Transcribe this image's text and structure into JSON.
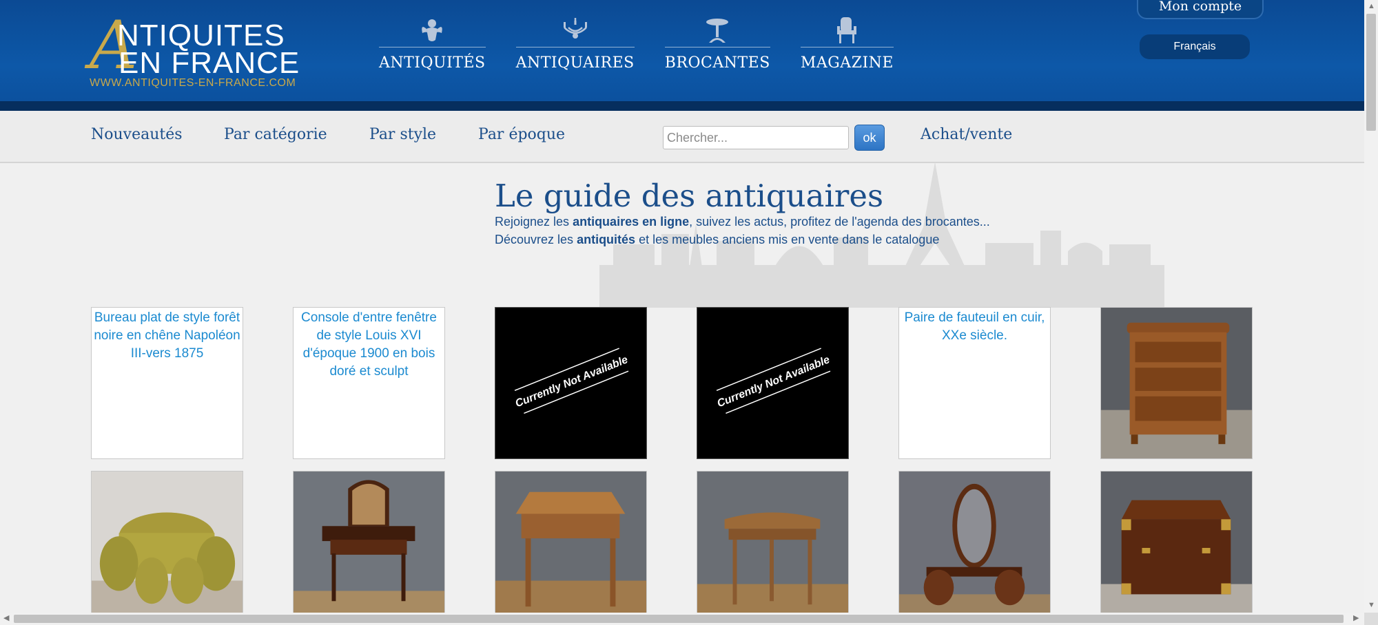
{
  "logo": {
    "initial": "A",
    "line1": "NTIQUITES",
    "line2": "EN FRANCE",
    "url": "WWW.ANTIQUITES-EN-FRANCE.COM",
    "gold": "#c9a94b"
  },
  "main_nav": [
    {
      "label": "ANTIQUITÉS",
      "icon": "cherub-icon"
    },
    {
      "label": "ANTIQUAIRES",
      "icon": "chandelier-icon"
    },
    {
      "label": "BROCANTES",
      "icon": "pedestal-table-icon"
    },
    {
      "label": "MAGAZINE",
      "icon": "armchair-icon"
    }
  ],
  "account": {
    "label": "Mon compte"
  },
  "language": {
    "label": "Français"
  },
  "sub_nav": {
    "links": [
      "Nouveautés",
      "Par catégorie",
      "Par style",
      "Par époque"
    ],
    "search_placeholder": "Chercher...",
    "ok_label": "ok",
    "buy_sell": "Achat/vente"
  },
  "page": {
    "title": "Le guide des antiquaires",
    "intro": {
      "l1_pre": "Rejoignez les ",
      "l1_bold": "antiquaires en ligne",
      "l1_post": ", suivez les actus, profitez de l'agenda des brocantes...",
      "l2_pre": "Découvrez les ",
      "l2_bold": "antiquités",
      "l2_post": " et les meubles anciens mis en vente dans le catalogue"
    }
  },
  "products": [
    {
      "kind": "alt",
      "alt": "Bureau plat de style forêt noire en chêne Napoléon III-vers 1875"
    },
    {
      "kind": "alt",
      "alt": "Console d'entre fenêtre de style Louis XVI d'époque 1900 en bois doré et sculpt"
    },
    {
      "kind": "unavailable",
      "text": "Currently Not Available"
    },
    {
      "kind": "unavailable",
      "text": "Currently Not Available"
    },
    {
      "kind": "alt",
      "alt": "Paire de fauteuil en cuir, XXe siècle."
    },
    {
      "kind": "photo",
      "photo": "chest-of-drawers"
    },
    {
      "kind": "photo",
      "photo": "yellow-salon-set"
    },
    {
      "kind": "photo",
      "photo": "dressing-table-mirror"
    },
    {
      "kind": "photo",
      "photo": "writing-desk"
    },
    {
      "kind": "photo",
      "photo": "demi-lune-console"
    },
    {
      "kind": "photo",
      "photo": "oval-mirror-vanity"
    },
    {
      "kind": "photo",
      "photo": "campaign-chest"
    }
  ],
  "colors": {
    "header_blue": "#0d58a8",
    "link_blue": "#1b4e8a",
    "alt_link": "#1b8ad0"
  }
}
